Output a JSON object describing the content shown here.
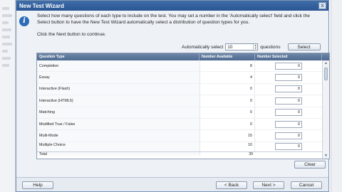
{
  "window": {
    "title": "New Test Wizard",
    "close_label": "x"
  },
  "info": {
    "text": "Select how many questions of each type to include on the test. You may set a number in the 'Automatically select' field and click the Select button to have the New Test Wizard automatically select a distribution of question types for you.",
    "continue": "Click the Next button to continue."
  },
  "auto_select": {
    "label": "Automatically select",
    "value": "10",
    "suffix": "questions",
    "button": "Select"
  },
  "grid": {
    "headers": [
      "Question Type",
      "Number Available",
      "Number Selected"
    ],
    "rows": [
      {
        "type": "Completion",
        "available": "8",
        "selected": "0"
      },
      {
        "type": "Essay",
        "available": "4",
        "selected": "0"
      },
      {
        "type": "Interactive (Flash)",
        "available": "0",
        "selected": "0"
      },
      {
        "type": "Interactive (HTML5)",
        "available": "0",
        "selected": "0"
      },
      {
        "type": "Matching",
        "available": "0",
        "selected": "0"
      },
      {
        "type": "Modified True / False",
        "available": "0",
        "selected": "0"
      },
      {
        "type": "Multi-Mode",
        "available": "15",
        "selected": "0"
      },
      {
        "type": "Multiple Choice",
        "available": "10",
        "selected": "0"
      }
    ],
    "total_label": "Total",
    "total_available": "39"
  },
  "buttons": {
    "clear": "Clear",
    "help": "Help",
    "back": "< Back",
    "next": "Next >",
    "cancel": "Cancel"
  }
}
